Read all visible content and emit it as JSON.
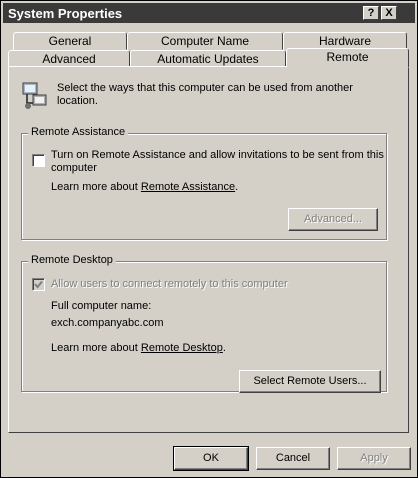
{
  "window": {
    "title": "System Properties",
    "help_glyph": "?",
    "close_glyph": "X"
  },
  "tabs": {
    "row1": [
      "General",
      "Computer Name",
      "Hardware"
    ],
    "row2": [
      "Advanced",
      "Automatic Updates",
      "Remote"
    ],
    "active": "Remote"
  },
  "intro": {
    "line1": "Select the ways that this computer can be used from another",
    "line2": "location."
  },
  "remote_assistance": {
    "title": "Remote Assistance",
    "checkbox_line1": "Turn on Remote Assistance and allow invitations to be sent from this",
    "checkbox_line2": "computer",
    "checked": false,
    "learn_prefix": "Learn more about",
    "learn_link": "Remote Assistance",
    "learn_suffix": ".",
    "advanced_button": "Advanced..."
  },
  "remote_desktop": {
    "title": "Remote Desktop",
    "checkbox_label": "Allow users to connect remotely to this computer",
    "checked": true,
    "computer_name_label": "Full computer name:",
    "computer_name": "exch.companyabc.com",
    "learn_prefix": "Learn more about",
    "learn_link": "Remote Desktop",
    "learn_suffix": ".",
    "select_users_button": "Select Remote Users..."
  },
  "footer": {
    "ok": "OK",
    "cancel": "Cancel",
    "apply": "Apply"
  },
  "icons": {
    "intro_icon": "computer-network-icon"
  }
}
